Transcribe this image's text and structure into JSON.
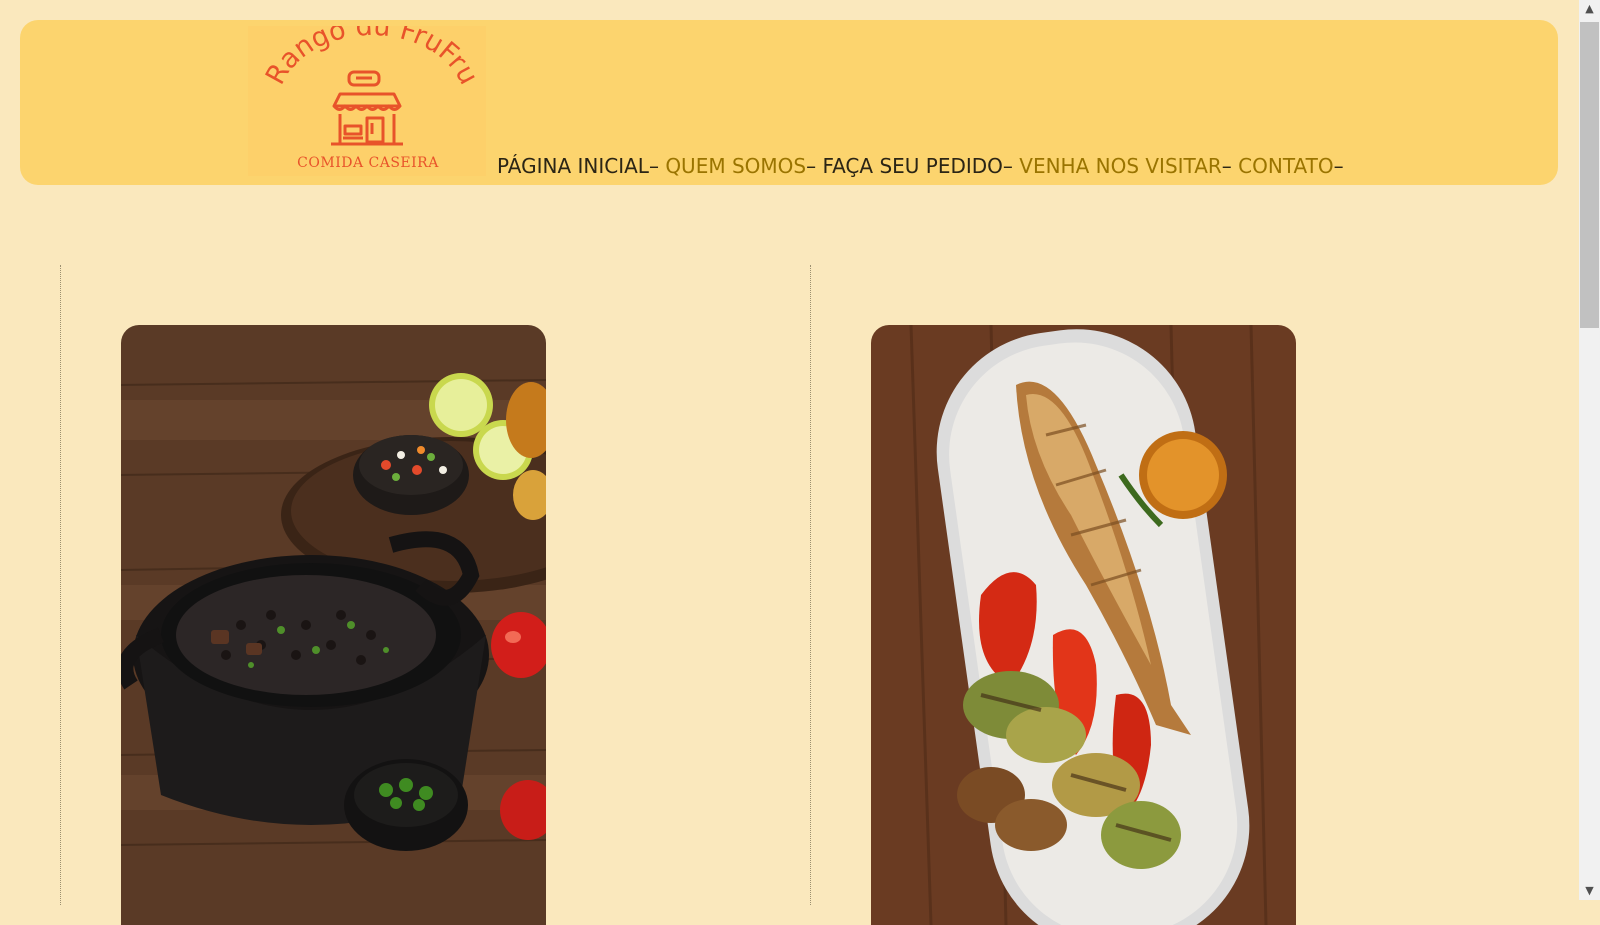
{
  "logo": {
    "name": "Rango du FruFru",
    "tagline": "COMIDA CASEIRA"
  },
  "nav": {
    "items": [
      {
        "label": "PÁGINA INICIAL",
        "sep": "–"
      },
      {
        "label": "QUEM SOMOS",
        "sep": "–"
      },
      {
        "label": "FAÇA SEU PEDIDO",
        "sep": "–"
      },
      {
        "label": "VENHA NOS VISITAR",
        "sep": "–"
      },
      {
        "label": "CONTATO",
        "sep": "–"
      }
    ]
  },
  "colors": {
    "page_bg": "#fae8bd",
    "header_bg": "#fcd46e",
    "logo_accent": "#e8532a",
    "nav_dark": "#2b2515",
    "nav_gold": "#9a7400"
  },
  "cards": [
    {
      "image": "feijoada-pot-photo"
    },
    {
      "image": "grilled-fish-plate-photo"
    }
  ]
}
